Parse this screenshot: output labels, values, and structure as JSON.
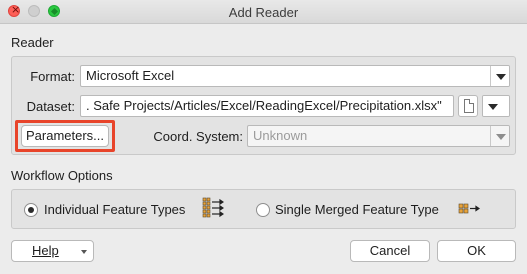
{
  "window": {
    "title": "Add Reader"
  },
  "reader": {
    "section_label": "Reader",
    "format_label": "Format:",
    "format_value": "Microsoft Excel",
    "dataset_label": "Dataset:",
    "dataset_value": ". Safe Projects/Articles/Excel/ReadingExcel/Precipitation.xlsx\"",
    "parameters_label": "Parameters...",
    "coord_label": "Coord. System:",
    "coord_value": "Unknown"
  },
  "workflow": {
    "section_label": "Workflow Options",
    "individual_label": "Individual Feature Types",
    "single_label": "Single Merged Feature Type",
    "selected": "individual"
  },
  "buttons": {
    "help": "Help",
    "cancel": "Cancel",
    "ok": "OK"
  },
  "colors": {
    "highlight": "#e8442a",
    "icon_fill": "#e8a33a"
  },
  "icons": {
    "individual": "multi-feature-types-icon",
    "single": "merged-feature-type-icon",
    "browse": "document-icon",
    "dropdown": "chevron-down-icon"
  }
}
